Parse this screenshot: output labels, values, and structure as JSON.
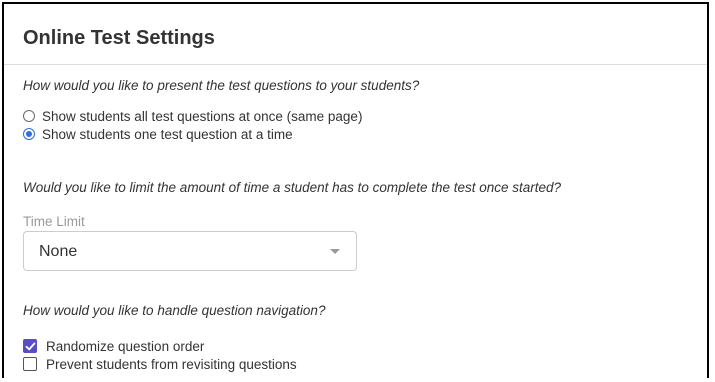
{
  "settings": {
    "title": "Online Test Settings",
    "presentation": {
      "question": "How would you like to present the test questions to your students?",
      "options": [
        {
          "label": "Show students all test questions at once (same page)",
          "selected": false
        },
        {
          "label": "Show students one test question at a time",
          "selected": true
        }
      ]
    },
    "time_limit": {
      "question": "Would you like to limit the amount of time a student has to complete the test once started?",
      "field_label": "Time Limit",
      "selected_value": "None"
    },
    "navigation": {
      "question": "How would you like to handle question navigation?",
      "options": [
        {
          "label": "Randomize question order",
          "checked": true
        },
        {
          "label": "Prevent students from revisiting questions",
          "checked": false
        }
      ]
    }
  },
  "colors": {
    "radio_accent": "#2f6fd6",
    "checkbox_accent": "#5b4cc4",
    "muted_label": "#9a9a9a",
    "text": "#333333"
  }
}
